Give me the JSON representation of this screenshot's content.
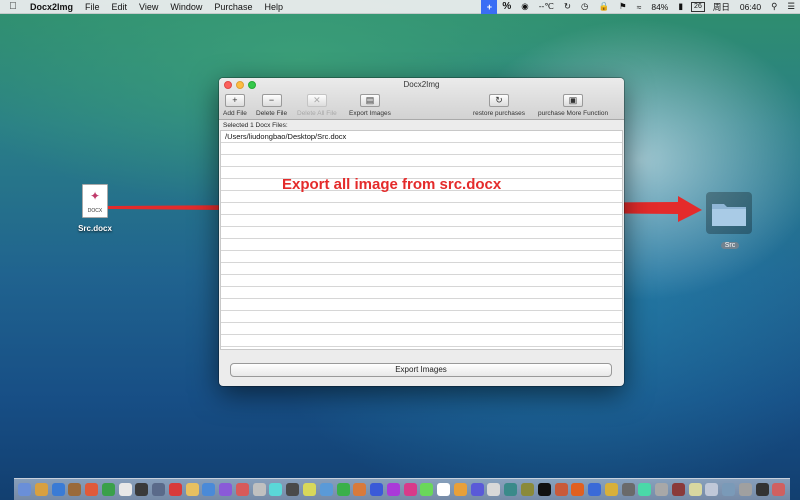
{
  "menubar": {
    "apple_icon": "apple-icon",
    "app_name": "Docx2Img",
    "items": [
      "File",
      "Edit",
      "View",
      "Window",
      "Purchase",
      "Help"
    ],
    "status": {
      "plus_icon": "+",
      "percent_icon": "%",
      "temperature": "--℃",
      "battery": "84%",
      "date_box": "26",
      "weekday": "周日",
      "time": "06:40"
    }
  },
  "desktop": {
    "file_label": "Src.docx",
    "file_ext": "DOCX",
    "folder_label": "Src"
  },
  "window": {
    "title": "Docx2Img",
    "toolbar": {
      "add": {
        "icon": "+",
        "label": "Add File"
      },
      "delete": {
        "icon": "−",
        "label": "Delete File"
      },
      "delete_all": {
        "icon": "✕",
        "label": "Delete All File"
      },
      "export": {
        "icon": "▤",
        "label": "Export Images"
      },
      "restore": {
        "icon": "↻",
        "label": "restore purchases"
      },
      "purchase": {
        "icon": "▣",
        "label": "purchase More Function"
      }
    },
    "list_header": "Selected 1 Docx Files:",
    "files": [
      "/Users/liudongbao/Desktop/Src.docx"
    ],
    "export_button": "Export Images"
  },
  "annotation": {
    "text": "Export  all image from src.docx",
    "color": "#e42b2b"
  },
  "dock": {
    "icon_colors": [
      "#6a8fd8",
      "#d8a040",
      "#3a7bd5",
      "#9a6a3a",
      "#e05a3a",
      "#3aa04a",
      "#e8e8e8",
      "#3a3a3a",
      "#5a6a8a",
      "#d83a3a",
      "#e8c060",
      "#4a8ad8",
      "#8a5ad8",
      "#d85a5a",
      "#c0c0c0",
      "#5ad8d8",
      "#4a4a4a",
      "#d8d85a",
      "#5a9ad8",
      "#3ab04a",
      "#d87a3a",
      "#3a5ad8",
      "#aa3ad8",
      "#d83a8a",
      "#6ad85a",
      "#ffffff",
      "#e8a03a",
      "#5a5ad8",
      "#d8d8d8",
      "#3a8a8a",
      "#8a8a3a",
      "#111111",
      "#c85a3a",
      "#e06020",
      "#3a6ad8",
      "#d8b03a",
      "#6a6a6a",
      "#4ad8a8",
      "#a8a8a8",
      "#8a3a3a",
      "#d8d8a0",
      "#c0c8d8",
      "#7a9ab8",
      "#a0a0a0",
      "#333333",
      "#d06060"
    ]
  }
}
